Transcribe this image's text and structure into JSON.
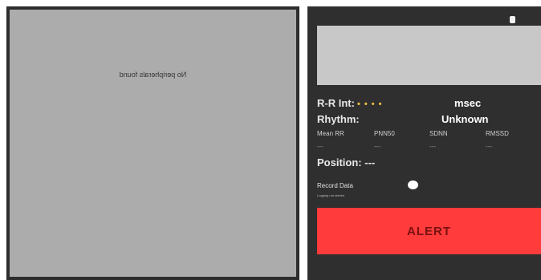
{
  "left_panel": {
    "message": "No peripherals found"
  },
  "right_panel": {
    "rr_interval": {
      "label": "R-R Int:",
      "value": "• • • •",
      "unit": "msec"
    },
    "rhythm": {
      "label": "Rhythm:",
      "value": "Unknown"
    },
    "metrics": {
      "labels": [
        "Mean RR",
        "PNN50",
        "SDNN",
        "RMSSD"
      ],
      "values": [
        "---",
        "---",
        "---",
        "---"
      ]
    },
    "position": {
      "label": "Position:",
      "value": "---"
    },
    "record": {
      "label": "Record Data",
      "status": "Logging not started",
      "enabled": true
    },
    "alert": {
      "label": "ALERT",
      "color": "#ff3b3b"
    }
  }
}
